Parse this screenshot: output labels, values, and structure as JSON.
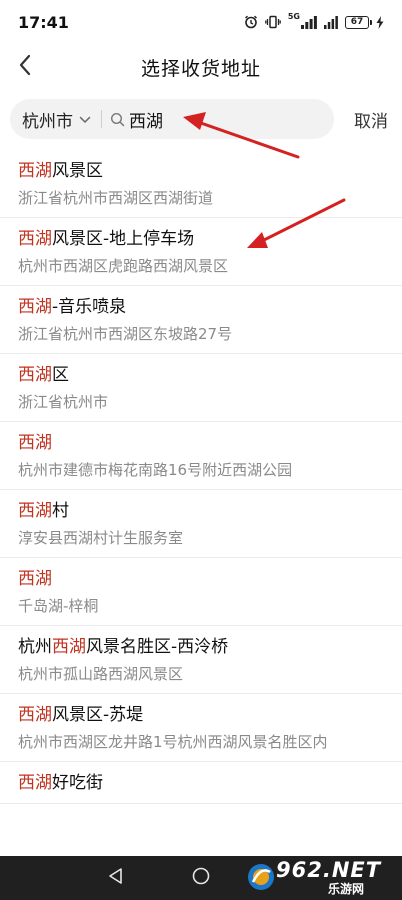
{
  "status_bar": {
    "time": "17:41",
    "network_label": "5G",
    "battery_level": "67"
  },
  "header": {
    "title": "选择收货地址"
  },
  "search": {
    "city": "杭州市",
    "query": "西湖",
    "cancel_label": "取消"
  },
  "results": [
    {
      "name_before": "",
      "name_highlight": "西湖",
      "name_after": "风景区",
      "address": "浙江省杭州市西湖区西湖街道"
    },
    {
      "name_before": "",
      "name_highlight": "西湖",
      "name_after": "风景区-地上停车场",
      "address": "杭州市西湖区虎跑路西湖风景区"
    },
    {
      "name_before": "",
      "name_highlight": "西湖",
      "name_after": "-音乐喷泉",
      "address": "浙江省杭州市西湖区东坡路27号"
    },
    {
      "name_before": "",
      "name_highlight": "西湖",
      "name_after": "区",
      "address": "浙江省杭州市"
    },
    {
      "name_before": "",
      "name_highlight": "西湖",
      "name_after": "",
      "address": "杭州市建德市梅花南路16号附近西湖公园"
    },
    {
      "name_before": "",
      "name_highlight": "西湖",
      "name_after": "村",
      "address": "淳安县西湖村计生服务室"
    },
    {
      "name_before": "",
      "name_highlight": "西湖",
      "name_after": "",
      "address": "千岛湖-梓桐"
    },
    {
      "name_before": "杭州",
      "name_highlight": "西湖",
      "name_after": "风景名胜区-西泠桥",
      "address": "杭州市孤山路西湖风景区"
    },
    {
      "name_before": "",
      "name_highlight": "西湖",
      "name_after": "风景区-苏堤",
      "address": "杭州市西湖区龙井路1号杭州西湖风景名胜区内"
    },
    {
      "name_before": "",
      "name_highlight": "西湖",
      "name_after": "好吃街",
      "address": ""
    }
  ],
  "watermark": {
    "brand": "962.NET",
    "site": "乐游网"
  },
  "colors": {
    "highlight": "#c1321f",
    "arrow": "#d42222",
    "nav_bar": "#202020"
  }
}
